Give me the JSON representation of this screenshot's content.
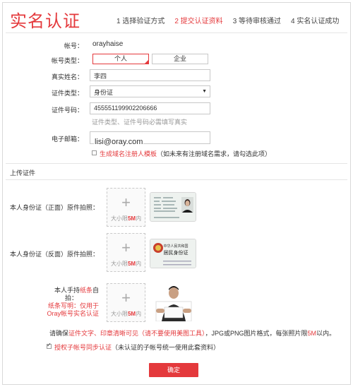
{
  "header": {
    "title": "实名认证",
    "steps": [
      {
        "label": "1 选择验证方式",
        "active": false
      },
      {
        "label": "2 提交认证资料",
        "active": true
      },
      {
        "label": "3 等待审核通过",
        "active": false
      },
      {
        "label": "4 实名认证成功",
        "active": false
      }
    ]
  },
  "form": {
    "account_label": "帐号：",
    "account_value": "orayhaise",
    "account_type_label": "帐号类型：",
    "account_type_options": [
      "个人",
      "企业"
    ],
    "account_type_selected": "个人",
    "real_name_label": "真实姓名：",
    "real_name_value": "李四",
    "id_type_label": "证件类型：",
    "id_type_value": "身份证",
    "id_number_label": "证件号码：",
    "id_number_value": "455551199902206666",
    "id_hint": "证件类型、证件号码必需填写真实",
    "email_label": "电子邮箱：",
    "email_value": "lisi@oray.com",
    "domain_template_checked": false,
    "domain_template_link": "生成域名注册人模板",
    "domain_template_note": "（如未来有注册域名需求，请勾选此项）"
  },
  "upload_section": {
    "title": "上传证件",
    "front_label": "本人身份证（正面）原件拍照：",
    "back_label": "本人身份证（反面）原件拍照：",
    "hold_label_line1": "本人手持",
    "hold_label_red1": "纸条",
    "hold_label_line1b": "自",
    "hold_label_line2": "拍：",
    "hold_note_line1": "纸条写明：仅用于",
    "hold_note_line2": "Oray帐号实名认证",
    "upload_caption_pre": "大小限",
    "upload_caption_size": "5M",
    "upload_caption_post": "内",
    "card_back_title": "中华人民共和国",
    "card_back_subtitle": "居民身份证"
  },
  "notes": {
    "ensure_pre": "请确保",
    "ensure_red": "证件文字、印章清晰可见（请不要使用美图工具）",
    "ensure_post": "，JPG或PNG图片格式，每张照片限",
    "ensure_size": "5M",
    "ensure_end": "以内。",
    "sync_checked": true,
    "sync_red": "授权子帐号同步认证",
    "sync_note": "（未认证的子帐号统一使用此套资料）"
  },
  "submit_label": "确定",
  "colors": {
    "accent": "#e4393c",
    "border": "#c8c8c8",
    "hint": "#999999"
  }
}
